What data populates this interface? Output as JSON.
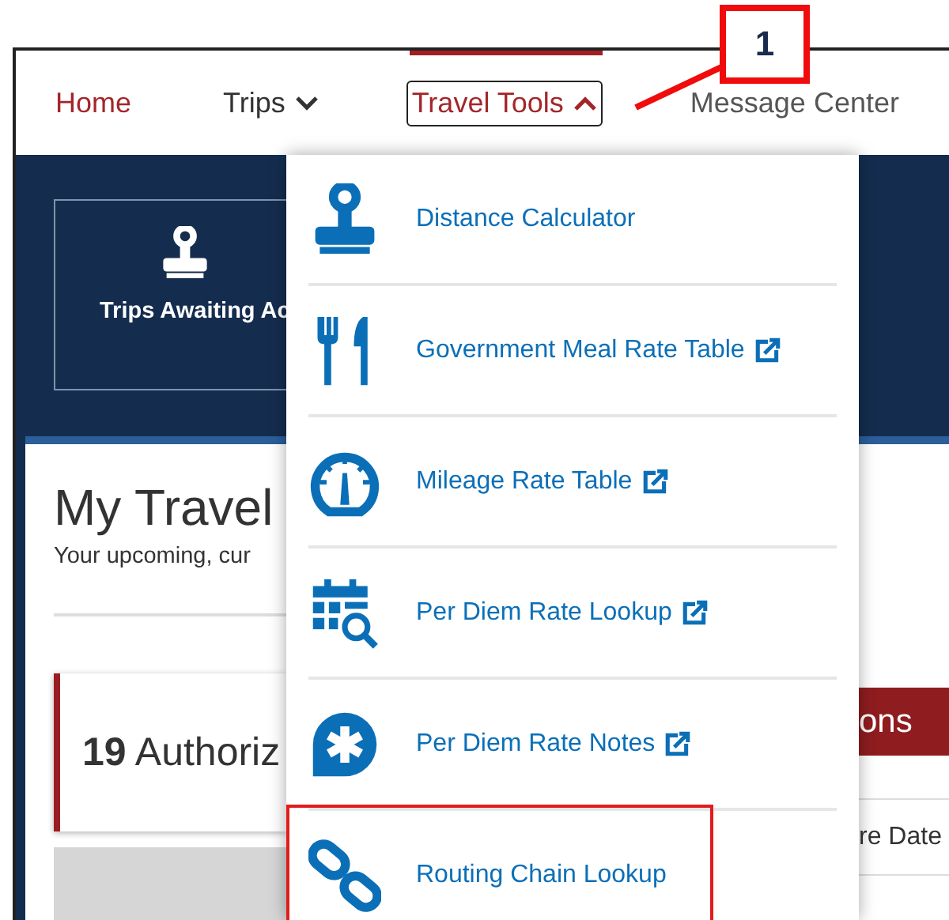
{
  "nav": {
    "items": [
      {
        "label": "Home",
        "kind": "link",
        "selected": true
      },
      {
        "label": "Trips",
        "kind": "menu",
        "expanded": false
      },
      {
        "label": "Travel Tools",
        "kind": "menu",
        "expanded": true
      },
      {
        "label": "Message Center",
        "kind": "link",
        "selected": false
      }
    ]
  },
  "callout": {
    "number": "1"
  },
  "dashboard": {
    "tile": {
      "label": "Trips Awaiting Ac"
    },
    "heading": "My Travel",
    "subtitle": "Your upcoming, cur",
    "summary": {
      "count": "19",
      "label": "Authoriz"
    },
    "tab_label": "ons",
    "column_header": "re Date"
  },
  "dropdown": {
    "items": [
      {
        "kind": "stamp",
        "label": "Distance Calculator",
        "external": false,
        "highlighted": false
      },
      {
        "kind": "utensils",
        "label": "Government Meal Rate Table",
        "external": true,
        "highlighted": false
      },
      {
        "kind": "gauge",
        "label": "Mileage Rate Table",
        "external": true,
        "highlighted": false
      },
      {
        "kind": "calendar",
        "label": "Per Diem Rate Lookup",
        "external": true,
        "highlighted": false
      },
      {
        "kind": "notes",
        "label": "Per Diem Rate Notes",
        "external": true,
        "highlighted": false
      },
      {
        "kind": "chain",
        "label": "Routing Chain Lookup",
        "external": false,
        "highlighted": true
      }
    ]
  }
}
